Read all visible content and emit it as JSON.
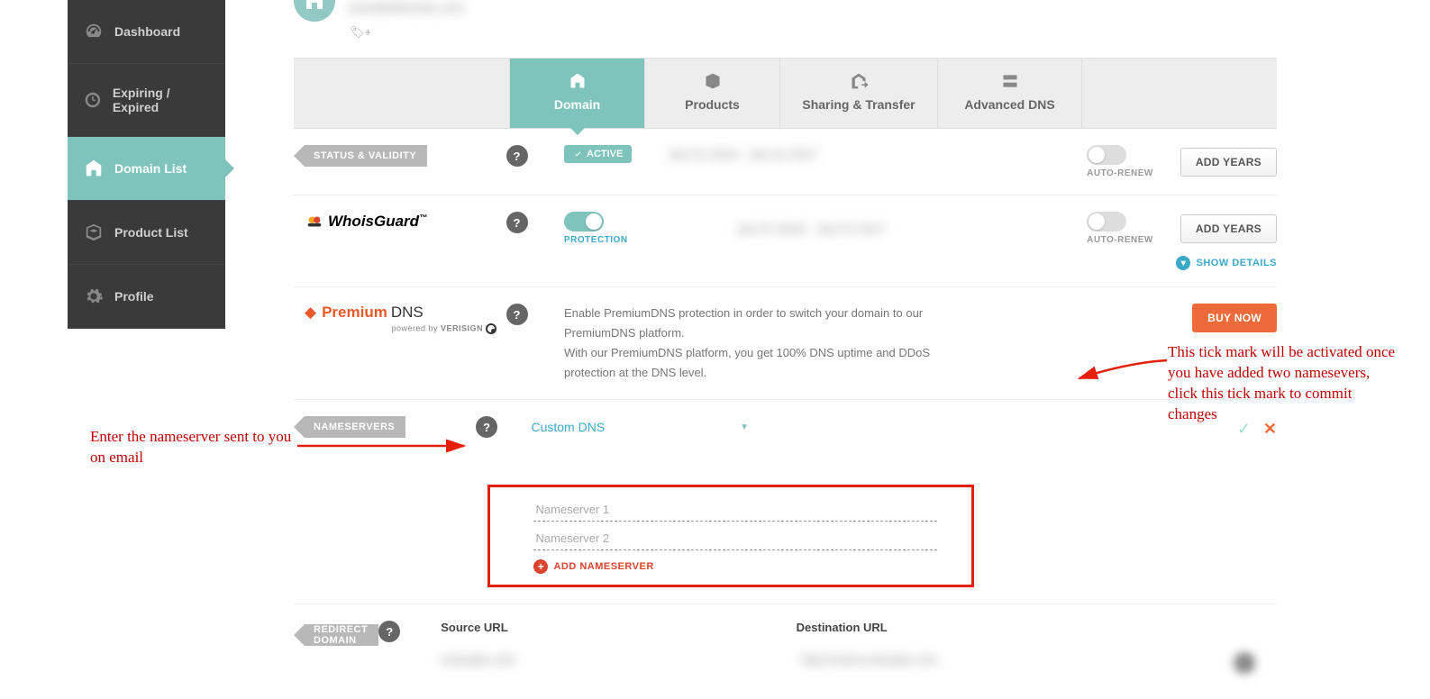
{
  "sidebar": {
    "items": [
      {
        "label": "Dashboard"
      },
      {
        "label": "Expiring / Expired"
      },
      {
        "label": "Domain List"
      },
      {
        "label": "Product List"
      },
      {
        "label": "Profile"
      }
    ]
  },
  "tabs": {
    "domain": "Domain",
    "products": "Products",
    "sharing": "Sharing & Transfer",
    "advanced": "Advanced DNS"
  },
  "status": {
    "chip": "STATUS & VALIDITY",
    "active": "ACTIVE",
    "autorenew": "AUTO-RENEW",
    "addyears": "ADD YEARS"
  },
  "whois": {
    "brand": "WhoisGuard",
    "tm": "™",
    "protection": "PROTECTION",
    "autorenew": "AUTO-RENEW",
    "addyears": "ADD YEARS",
    "showdetails": "SHOW DETAILS"
  },
  "premium": {
    "pre": "Premium",
    "dns": "DNS",
    "powered": "powered by",
    "verisign": "VERISIGN",
    "desc1": "Enable PremiumDNS protection in order to switch your domain to our PremiumDNS platform.",
    "desc2": "With our PremiumDNS platform, you get 100% DNS uptime and DDoS protection at the DNS level.",
    "buynow": "BUY NOW"
  },
  "ns": {
    "chip": "NAMESERVERS",
    "select": "Custom DNS",
    "ph1": "Nameserver 1",
    "ph2": "Nameserver 2",
    "add": "ADD NAMESERVER"
  },
  "redirect": {
    "chip": "REDIRECT DOMAIN",
    "source": "Source URL",
    "dest": "Destination URL"
  },
  "annotations": {
    "left": "Enter the nameserver sent to you on email",
    "right": "This tick mark will be activated once you have added two namesevers, click this tick mark to commit changes"
  },
  "help": "?"
}
